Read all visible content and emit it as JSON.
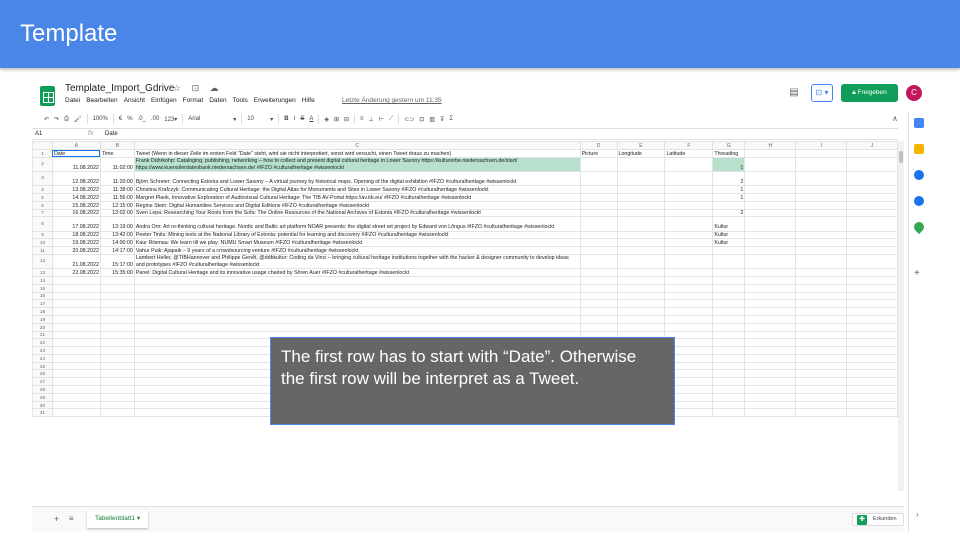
{
  "slide": {
    "title": "Template",
    "callout": "The first row has to start with “Date”. Otherwise the first row will be interpret as a Tweet."
  },
  "app": {
    "doc_title": "Template_Import_Gdrive",
    "title_icons": "☆ ⊡ ☁",
    "menu": [
      "Datei",
      "Bearbeiten",
      "Ansicht",
      "Einfügen",
      "Format",
      "Daten",
      "Tools",
      "Erweiterungen",
      "Hilfe"
    ],
    "last_edit": "Letzte Änderung gestern um 11:35",
    "share_label": "Freigeben",
    "avatar_letter": "C",
    "present_label": "⊡ ▾",
    "comment_icon": "▤"
  },
  "toolbar": {
    "zoom": "100%",
    "currency": "€",
    "percent": "%",
    "dec_less": ".0_",
    "dec_more": ".00",
    "more_formats": "123▾",
    "font": "Arial",
    "font_size": "10"
  },
  "formula_bar": {
    "cell_ref": "A1",
    "fx": "fx",
    "value": "Date"
  },
  "grid": {
    "columns": [
      "",
      "A",
      "B",
      "C",
      "D",
      "E",
      "F",
      "G",
      "H",
      "I",
      "J"
    ],
    "header_row": [
      "Date",
      "Time",
      "Tweet (Wenn in dieser Zeile im ersten Feld \"Date\" steht, wird sie nicht interpretiert, sonst wird versucht, einen Tweet draus zu machen)",
      "Picture",
      "Longitude",
      "Latitude",
      "Threading"
    ],
    "rows": [
      {
        "n": "2",
        "date": "11.08.2022",
        "time": "11:02:00",
        "tweet": "Frank Dührkohp: Cataloging, publishing, networking – how to collect and present digital cultural heritage in Lower Saxony https://kulturerbe.niedersachsen.de/start/ https://www.kuenstlerdatenbank.niedersachsen.de/ #IFZO #culturalheritage #wissenlockt",
        "threading": "1",
        "tall": true,
        "hl": true
      },
      {
        "n": "3",
        "date": "12.08.2022",
        "time": "11:20:00",
        "tweet": "Björn Schreier: Connecting Estonia and Lower Saxony – A virtual journey by historical maps. Opening of the digital exhibition #IFZO #culturalheritage #wissenlockt",
        "threading": "2",
        "tall": true
      },
      {
        "n": "4",
        "date": "13.08.2022",
        "time": "11:38:00",
        "tweet": "Christina Krafczyk: Communicating Cultural Heritage: the Digital Atlas for Monuments and Sites in Lower Saxony #IFZO #culturalheritage #wissenlockt",
        "threading": "1"
      },
      {
        "n": "5",
        "date": "14.08.2022",
        "time": "11:56:00",
        "tweet": "Margret Plank, Innovative Exploration of Audiovisual Cultural Heritage: The TIB AV-Portal https://av.tib.eu/ #IFZO #culturalheritage #wissenlockt",
        "threading": "1"
      },
      {
        "n": "6",
        "date": "15.08.2022",
        "time": "12:15:00",
        "tweet": "Regine Stein: Digital Humanities Services and Digital Editions #IFZO #culturalheritage #wissenlockt",
        "threading": ""
      },
      {
        "n": "7",
        "date": "16.08.2022",
        "time": "13:02:00",
        "tweet": "Sven Lepa: Researching Your Roots from the Sofa: The Online Resources of the National Archives of Estonia #IFZO #culturalheritage #wissenlockt",
        "threading": "2"
      },
      {
        "n": "8",
        "date": "17.08.2022",
        "time": "13:19:00",
        "tweet": "Andra Orn: Art re-thinking cultural heritage. Nordic and Baltic art platform NOAR presents: the digital street art project by Edward von Lõngus #IFZO #culturalheritage #wissenlockt",
        "threading": "Kultur",
        "tall": true
      },
      {
        "n": "9",
        "date": "18.08.2022",
        "time": "13:42:00",
        "tweet": "Peeter Tinits: Mining texts at the National Library of Estonia: potential for learning and discovery #IFZO #culturalheritage #wissenlockt",
        "threading": "Kultur"
      },
      {
        "n": "10",
        "date": "19.08.2022",
        "time": "14:00:00",
        "tweet": "Kaur Riismaa: We learn till we play: NUMU Smart Museum #IFZO #culturalheritage #wissenlockt",
        "threading": "Kultur"
      },
      {
        "n": "11",
        "date": "20.08.2022",
        "time": "14:17:00",
        "tweet": "Vahur Puik: Ajapaik – 9 years of a crowdsourcing venture #IFZO #culturalheritage #wissenlockt",
        "threading": ""
      },
      {
        "n": "12",
        "date": "21.08.2022",
        "time": "15:17:00",
        "tweet": "Lambert Heller, @TIBHannover and Philippe Genêt, @ddbkultur: Coding da Vinci – bringing cultural heritage institutions together with the hacker & designer community to develop ideas and prototypes #IFZO #culturalheritage #wissenlockt",
        "threading": "",
        "tall": true
      },
      {
        "n": "13",
        "date": "22.08.2022",
        "time": "15:35:00",
        "tweet": "Panel: Digital Cultural Heritage and its innovative usage chaired by Sören Auer #IFZO #culturalheritage #wissenlockt",
        "threading": ""
      }
    ],
    "empty_rows": [
      "14",
      "15",
      "16",
      "17",
      "18",
      "19",
      "20",
      "21",
      "22",
      "23",
      "24",
      "25",
      "26",
      "27",
      "28",
      "29",
      "30",
      "31"
    ]
  },
  "bottom": {
    "add_icon": "+",
    "all_sheets_icon": "≡",
    "sheet_tab": "Tabellenblatt1 ▾",
    "explore": "Erkunden"
  },
  "side_panel": {
    "icons": [
      {
        "name": "calendar",
        "color": "#4285f4"
      },
      {
        "name": "keep",
        "color": "#f4b400"
      },
      {
        "name": "tasks",
        "color": "#1a73e8"
      },
      {
        "name": "contacts",
        "color": "#1a73e8"
      },
      {
        "name": "maps",
        "color": "#34a853"
      }
    ],
    "add": "+",
    "expand": "›"
  }
}
